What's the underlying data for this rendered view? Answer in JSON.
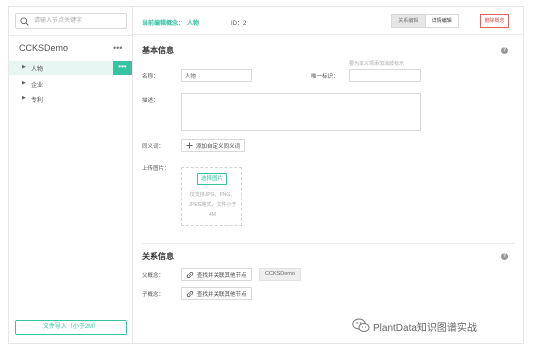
{
  "sidebar": {
    "search_placeholder": "请输入节点关键字",
    "project_name": "CCKSDemo",
    "more_symbol": "•••",
    "tree_items": [
      {
        "label": "人物",
        "active": true
      },
      {
        "label": "企业",
        "active": false
      },
      {
        "label": "专利",
        "active": false
      }
    ],
    "import_button": "文件导入（小于2M）"
  },
  "header": {
    "current_label": "当前编辑概念：",
    "current_name": "人物",
    "id_text": "ID：2",
    "tabs": [
      {
        "label": "关系编辑",
        "active": false
      },
      {
        "label": "详情编辑",
        "active": true
      }
    ],
    "delete_button": "删除概念"
  },
  "basic": {
    "section_title": "基本信息",
    "help_symbol": "?",
    "name_label": "名称：",
    "name_value": "人物",
    "unique_label": "唯一标识：",
    "unique_hint": "要为本义项添加消歧标示",
    "unique_value": "",
    "desc_label": "描述：",
    "desc_value": "",
    "synonym_label": "同义词：",
    "add_synonym_button": "添加自定义同义词",
    "upload_label": "上传图片：",
    "select_image_button": "选择图片",
    "upload_hint_lines": [
      "仅支持JPG、PNG、",
      "JPEG格式，文件小于",
      "4M"
    ]
  },
  "relation": {
    "section_title": "关系信息",
    "help_symbol": "?",
    "parent_label": "父概念：",
    "find_parent_button": "查找并关联其他节点",
    "parent_tag": "CCKSDemo",
    "child_label": "子概念：",
    "find_child_button": "查找并关联其他节点"
  },
  "watermark": {
    "text": "PlantData知识图谱实战"
  },
  "colors": {
    "accent": "#36c3a1",
    "danger": "#e05050",
    "active_tree_bg": "#e8f6f3"
  }
}
